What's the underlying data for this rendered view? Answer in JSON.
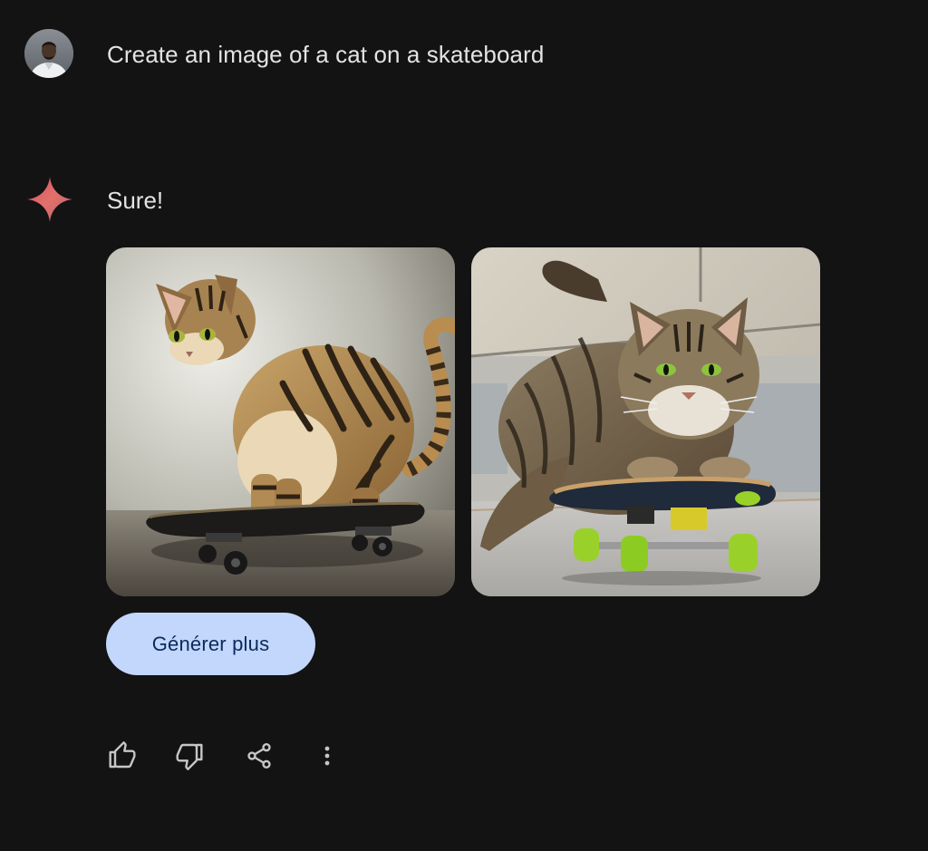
{
  "conversation": {
    "user": {
      "prompt": "Create an image of a cat on a skateboard",
      "avatar_icon": "user-avatar"
    },
    "model": {
      "response_text": "Sure!",
      "images": [
        {
          "subject": "striped tabby cat standing on black skateboard, studio background"
        },
        {
          "subject": "tabby cat riding skateboard with green wheels, outdoor wall background"
        }
      ],
      "generate_more_label": "Générer plus"
    },
    "actions": [
      {
        "icon": "thumb-up-icon"
      },
      {
        "icon": "thumb-down-icon"
      },
      {
        "icon": "share-icon"
      },
      {
        "icon": "more-vert-icon"
      }
    ]
  },
  "colors": {
    "background": "#131314",
    "text": "#e3e3e3",
    "button_bg": "#c2d7fb",
    "button_text": "#0b2a5c",
    "icon": "#c4c7c5"
  }
}
